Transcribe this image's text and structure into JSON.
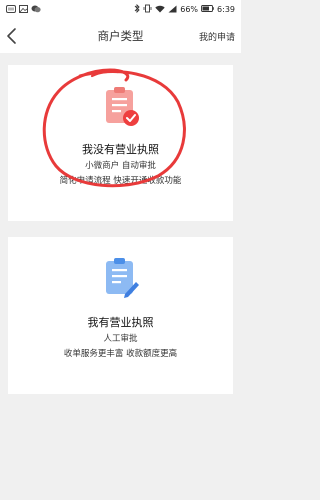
{
  "status_bar": {
    "battery": "66%",
    "time": "6:39"
  },
  "nav": {
    "title": "商户类型",
    "action": "我的申请"
  },
  "cards": [
    {
      "title": "我没有营业执照",
      "line1": "小微商户 自动审批",
      "line2": "简化申请流程 快速开通收款功能",
      "icon": "document-check-icon",
      "icon_color": "#f07c78"
    },
    {
      "title": "我有营业执照",
      "line1": "人工审批",
      "line2": "收单服务更丰富 收款额度更高",
      "icon": "document-edit-icon",
      "icon_color": "#4c8fe8"
    }
  ],
  "annotation_color": "#e83a3a"
}
